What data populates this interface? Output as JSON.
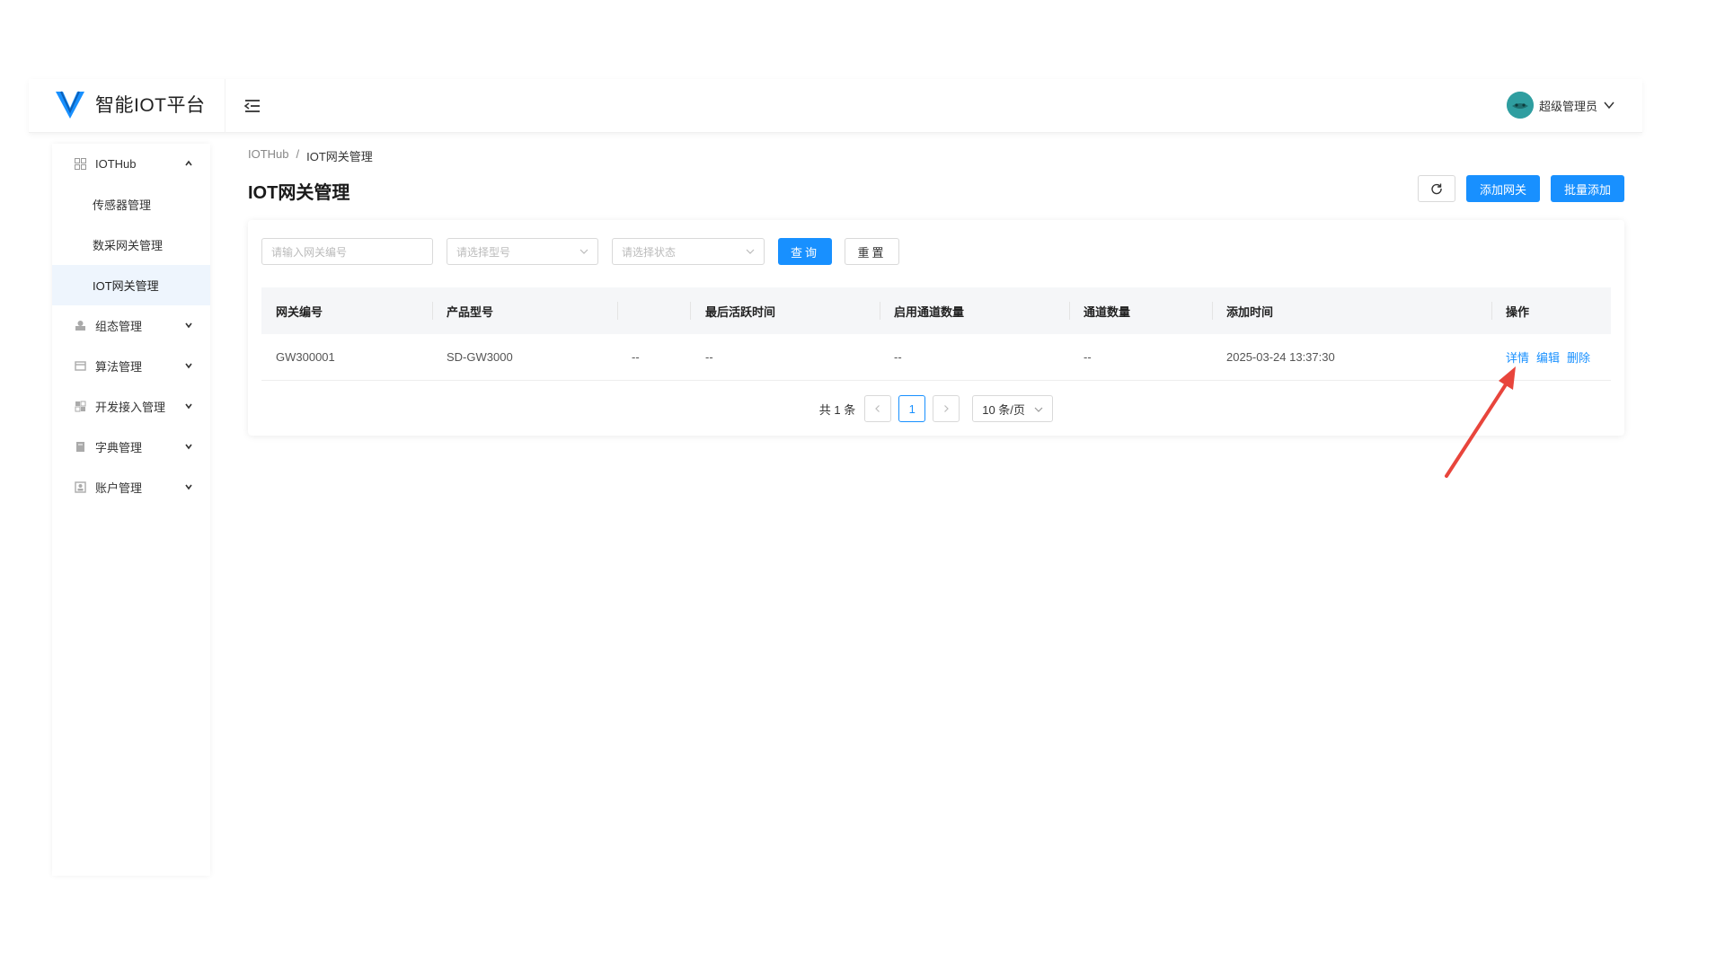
{
  "app": {
    "title": "智能IOT平台"
  },
  "user": {
    "name": "超级管理员"
  },
  "sidebar": {
    "groups": [
      {
        "label": "IOTHub",
        "icon": "grid-icon",
        "expanded": true,
        "children": [
          "传感器管理",
          "数采网关管理",
          "IOT网关管理"
        ]
      },
      {
        "label": "组态管理",
        "icon": "config-icon"
      },
      {
        "label": "算法管理",
        "icon": "algorithm-icon"
      },
      {
        "label": "开发接入管理",
        "icon": "dev-access-icon"
      },
      {
        "label": "字典管理",
        "icon": "dictionary-icon"
      },
      {
        "label": "账户管理",
        "icon": "account-icon"
      }
    ],
    "active_item": "IOT网关管理"
  },
  "breadcrumb": {
    "root": "IOTHub",
    "separator": "/",
    "current": "IOT网关管理"
  },
  "page": {
    "title": "IOT网关管理"
  },
  "toolbar": {
    "add_label": "添加网关",
    "batch_label": "批量添加"
  },
  "filters": {
    "code_placeholder": "请输入网关编号",
    "model_placeholder": "请选择型号",
    "status_placeholder": "请选择状态",
    "query_label": "查询",
    "reset_label": "重置"
  },
  "table": {
    "headers": [
      "网关编号",
      "产品型号",
      "",
      "最后活跃时间",
      "启用通道数量",
      "通道数量",
      "添加时间",
      "操作"
    ],
    "rows": [
      {
        "code": "GW300001",
        "model": "SD-GW3000",
        "status": "--",
        "last_active": "--",
        "enabled_channels": "--",
        "channels": "--",
        "added_time": "2025-03-24 13:37:30"
      }
    ],
    "actions": [
      "详情",
      "编辑",
      "删除"
    ]
  },
  "pagination": {
    "total_text": "共 1 条",
    "current_page": "1",
    "page_size": "10 条/页"
  },
  "colors": {
    "primary": "#1890ff",
    "annotation": "#e8453c"
  }
}
